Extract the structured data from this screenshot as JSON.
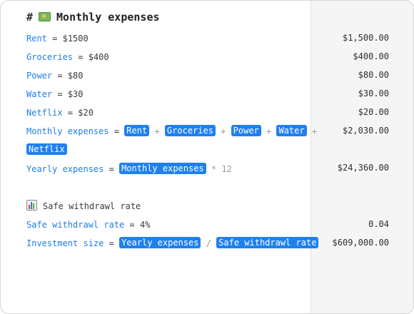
{
  "header": {
    "hash": "#",
    "icon": "money-icon",
    "title": "Monthly expenses"
  },
  "lines": {
    "rent": {
      "var": "Rent",
      "op": "=",
      "value": "$1500",
      "result": "$1,500.00"
    },
    "groceries": {
      "var": "Groceries",
      "op": "=",
      "value": "$400",
      "result": "$400.00"
    },
    "power": {
      "var": "Power",
      "op": "=",
      "value": "$80",
      "result": "$80.00"
    },
    "water": {
      "var": "Water",
      "op": "=",
      "value": "$30",
      "result": "$30.00"
    },
    "netflix": {
      "var": "Netflix",
      "op": "=",
      "value": "$20",
      "result": "$20.00"
    },
    "monthly": {
      "var": "Monthly expenses",
      "op": "=",
      "plus": "+",
      "refs": [
        "Rent",
        "Groceries",
        "Power",
        "Water",
        "Netflix"
      ],
      "result": "$2,030.00"
    },
    "yearly": {
      "var": "Yearly expenses",
      "op": "=",
      "ref": "Monthly expenses",
      "times": "* 12",
      "result": "$24,360.00"
    },
    "section": {
      "icon": "bar-chart-icon",
      "title": "Safe withdrawl rate"
    },
    "swr": {
      "var": "Safe withdrawl rate",
      "op": "=",
      "value": "4%",
      "result": "0.04"
    },
    "investment": {
      "var": "Investment size",
      "op": "=",
      "refs": [
        "Yearly expenses",
        "Safe withdrawl rate"
      ],
      "div": "/",
      "result": "$609,000.00"
    }
  }
}
